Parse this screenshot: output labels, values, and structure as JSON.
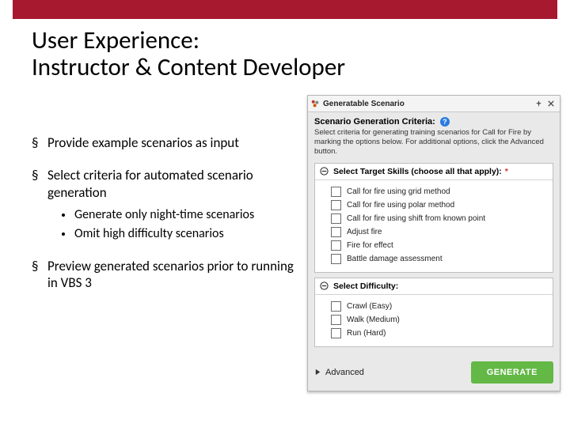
{
  "title": {
    "line1": "User Experience:",
    "line2": "Instructor & Content Developer"
  },
  "bullets": {
    "b1": "Provide example scenarios as input",
    "b2": "Select criteria for automated scenario generation",
    "b2a": "Generate only night-time scenarios",
    "b2b": "Omit high difficulty scenarios",
    "b3": "Preview generated scenarios prior to running in VBS 3"
  },
  "panel": {
    "window_title": "Generatable Scenario",
    "heading": "Scenario Generation Criteria:",
    "help_symbol": "?",
    "description": "Select criteria for generating training scenarios for Call for Fire by marking the options below. For additional options, click the Advanced button.",
    "skills": {
      "header": "Select Target Skills (choose all that apply):",
      "star": "*",
      "options": [
        "Call for fire using grid method",
        "Call for fire using polar method",
        "Call for fire using shift from known point",
        "Adjust fire",
        "Fire for effect",
        "Battle damage assessment"
      ]
    },
    "difficulty": {
      "header": "Select Difficulty:",
      "options": [
        "Crawl (Easy)",
        "Walk (Medium)",
        "Run (Hard)"
      ]
    },
    "advanced_label": "Advanced",
    "generate_label": "GENERATE"
  }
}
